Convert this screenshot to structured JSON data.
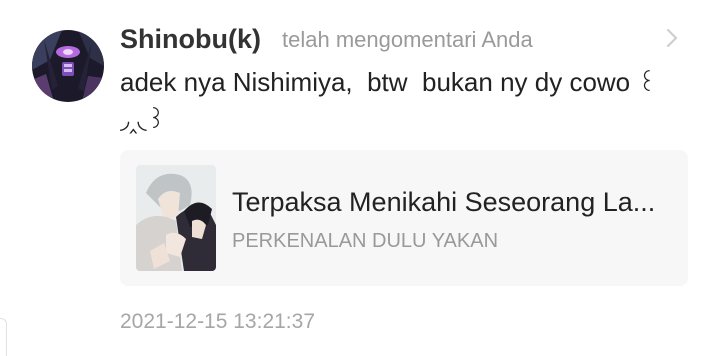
{
  "notification": {
    "username": "Shinobu(k)",
    "action": "telah mengomentari Anda",
    "comment": "adek nya Nishimiya,  btw  bukan ny dy cowo ꒰ ◞‸◟ ꒱",
    "comment_main": "adek nya Nishimiya,  btw  bukan ny dy cowo ",
    "comment_emoticon_line1": "꒰",
    "comment_emoticon_line2": "◞‸◟꒱",
    "timestamp": "2021-12-15 13:21:37",
    "avatar_icon": "avatar-anime-character",
    "chevron_icon": "chevron-right-icon"
  },
  "card": {
    "title": "Terpaksa Menikahi Seseorang La...",
    "subtitle": "PERKENALAN DULU YAKAN",
    "thumbnail_icon": "comic-cover-thumbnail"
  },
  "colors": {
    "username": "#333333",
    "secondary_text": "#9a9a9a",
    "card_background": "#f7f7f7",
    "timestamp": "#a6a6a6"
  }
}
